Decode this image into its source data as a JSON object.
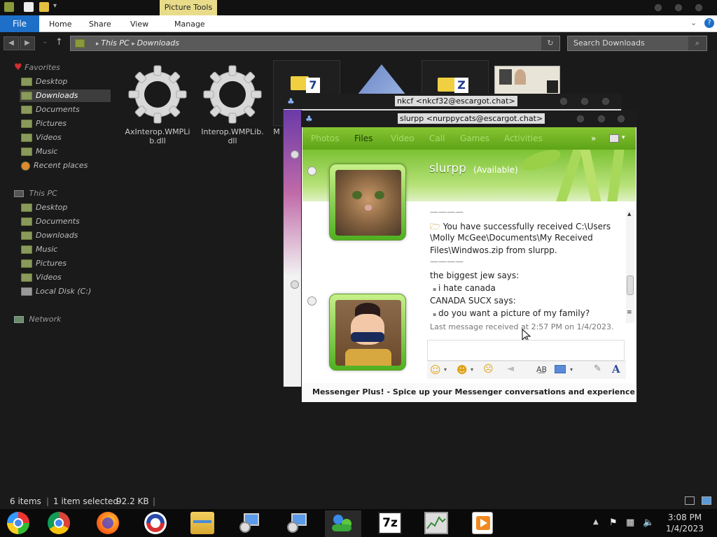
{
  "ribbon": {
    "contextual_tab": "Picture Tools",
    "tabs": [
      "File",
      "Home",
      "Share",
      "View",
      "Manage"
    ]
  },
  "address": {
    "path": [
      "This PC",
      "Downloads"
    ],
    "search_placeholder": "Search Downloads"
  },
  "sidebar": {
    "favorites_label": "Favorites",
    "favorites": [
      "Desktop",
      "Downloads",
      "Documents",
      "Pictures",
      "Videos",
      "Music",
      "Recent places"
    ],
    "thispc_label": "This PC",
    "thispc": [
      "Desktop",
      "Documents",
      "Downloads",
      "Music",
      "Pictures",
      "Videos",
      "Local Disk (C:)"
    ],
    "network_label": "Network"
  },
  "files": [
    {
      "name_line1": "AxInterop.WMPLi",
      "name_line2": "b.dll",
      "icon": "gear-icon"
    },
    {
      "name_line1": "Interop.WMPLib.",
      "name_line2": "dll",
      "icon": "gear-icon"
    },
    {
      "name_line1": "M",
      "icon": "7zip-icon"
    }
  ],
  "messenger_back": {
    "title": "nkcf <nkcf32@escargot.chat>"
  },
  "messenger": {
    "title": "slurpp <nurppycats@escargot.chat>",
    "tabs": [
      "Photos",
      "Files",
      "Video",
      "Call",
      "Games",
      "Activities"
    ],
    "contact_name": "slurpp",
    "contact_status": "(Available)",
    "messages": {
      "sep": "————",
      "file_line1": "You have successfully received C:\\Users",
      "file_line2": "\\Molly McGee\\Documents\\My Received",
      "file_line3": "Files\\Windwos.zip from slurpp.",
      "sender1": "the biggest jew says:",
      "msg1": "i hate canada",
      "sender2": "CANADA SUCX says:",
      "msg2": "do you want a picture of my family?",
      "last_received": "Last message received at 2:57 PM on 1/4/2023."
    },
    "footer": "Messenger Plus! - Spice up your Messenger conversations and experience w...",
    "colors": {
      "accent": "#7cc235",
      "toolbar": "#6bb022"
    }
  },
  "explorer_status": {
    "items": "6 items",
    "selected": "1 item selected",
    "size": "92.2 KB"
  },
  "taskbar": {
    "apps": [
      "start-icon",
      "chrome-icon",
      "firefox-icon",
      "obama-icon",
      "file-explorer-icon",
      "network-tool-icon",
      "network-tool-icon-2",
      "messenger-icon",
      "7zip-icon",
      "task-manager-icon",
      "media-player-icon"
    ],
    "time": "3:08 PM",
    "date": "1/4/2023"
  }
}
